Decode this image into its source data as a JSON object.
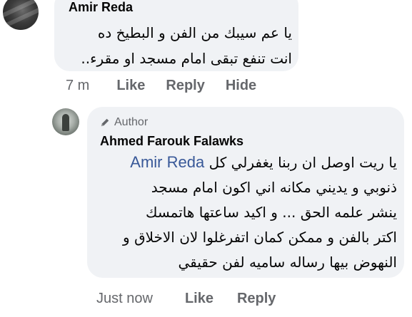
{
  "comment1": {
    "author": "Amir Reda",
    "lines": [
      "يا عم سيبك من الفن و البطيخ ده",
      "انت تنفع تبقى امام مسجد او مقرء.."
    ],
    "time": "7 m",
    "like_label": "Like",
    "reply_label": "Reply",
    "hide_label": "Hide"
  },
  "comment2": {
    "badge": "Author",
    "author": "Ahmed Farouk Falawks",
    "mention": "Amir Reda",
    "first_line_rest": " يا ريت اوصل ان ربنا يغفرلي كل",
    "lines": [
      "ذنوبي و يديني مكانه اني اكون امام مسجد",
      "ينشر علمه الحق ... و اكيد ساعتها هاتمسك",
      "اكتر بالفن و ممكن كمان اتفرغلوا لان الاخلاق و",
      "النهوض بيها رساله ساميه لفن حقيقي"
    ],
    "time": "Just now",
    "like_label": "Like",
    "reply_label": "Reply"
  },
  "icons": {
    "author_badge": "pencil-icon"
  }
}
